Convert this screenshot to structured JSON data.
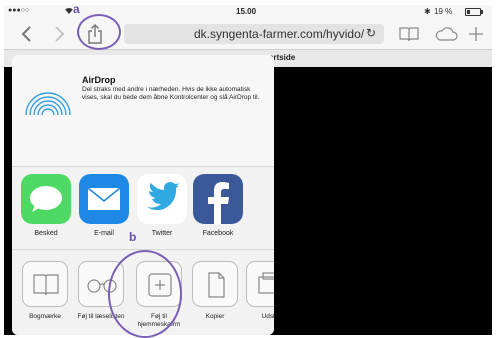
{
  "status_bar": {
    "signal": "●●●○○",
    "time": "15.00",
    "battery": "19 %"
  },
  "toolbar": {
    "url": "dk.syngenta-farmer.com/hyvido/"
  },
  "background_page": {
    "tab_text": "artside"
  },
  "airdrop": {
    "title": "AirDrop",
    "description": "Del straks med andre i nærheden. Hvis de ikke automatisk vises, skal du bede dem åbne Kontrolcenter og slå AirDrop til."
  },
  "apps": [
    {
      "label": "Besked",
      "icon": "messages-icon",
      "color": "#4cd964"
    },
    {
      "label": "E-mail",
      "icon": "mail-icon",
      "color": "#1e88e5"
    },
    {
      "label": "Twitter",
      "icon": "twitter-icon",
      "color": "#ffffff"
    },
    {
      "label": "Facebook",
      "icon": "facebook-icon",
      "color": "#3b5998"
    }
  ],
  "actions": [
    {
      "label": "Bogmærke",
      "icon": "book-icon"
    },
    {
      "label": "Føj til læselisten",
      "icon": "glasses-icon"
    },
    {
      "label": "Føj til hjemmeskærm",
      "icon": "add-to-home-icon"
    },
    {
      "label": "Kopier",
      "icon": "copy-icon"
    },
    {
      "label": "Udsk",
      "icon": "print-icon"
    }
  ],
  "annotations": {
    "a": "a",
    "b": "b",
    "color": "#7a5fb5"
  }
}
